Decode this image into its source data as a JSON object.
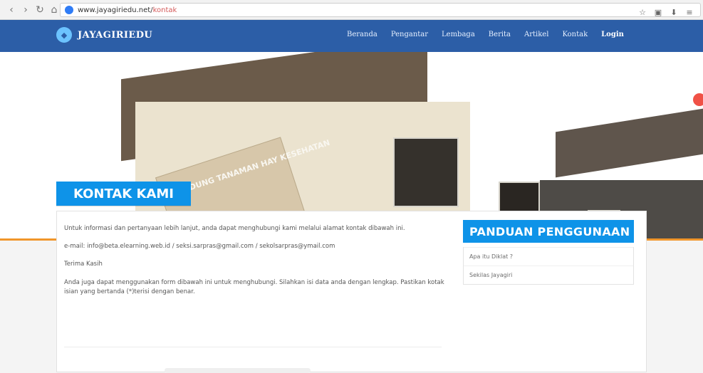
{
  "browser": {
    "url_domain": "www.jayagiriedu.net/",
    "url_path": "kontak"
  },
  "site": {
    "brand": "JAYAGIRIEDU",
    "menu": [
      "Beranda",
      "Pengantar",
      "Lembaga",
      "Berita",
      "Artikel",
      "Kontak",
      "Login"
    ]
  },
  "hero": {
    "sign_text": "GEDUNG TANAMAN HAY KESEHATAN"
  },
  "contact": {
    "label": "KONTAK KAMI",
    "paragraphs": [
      "Untuk informasi dan pertanyaan lebih lanjut, anda dapat menghubungi kami melalui alamat kontak dibawah ini.",
      "e-mail: info@beta.elearning.web.id / seksi.sarpras@gmail.com / sekolsarpras@ymail.com",
      "Terima Kasih",
      "Anda juga dapat menggunakan form dibawah ini untuk menghubungi. Silahkan isi data anda dengan lengkap. Pastikan kotak isian yang bertanda (*)terisi dengan benar."
    ]
  },
  "sidebar": {
    "title": "PANDUAN PENGGUNAAN",
    "items": [
      "Apa itu Diklat ?",
      "Sekilas Jayagiri"
    ]
  },
  "colors": {
    "header_blue": "#2c5ea7",
    "accent_blue": "#0e93e8",
    "accent_orange": "#f0962b"
  }
}
